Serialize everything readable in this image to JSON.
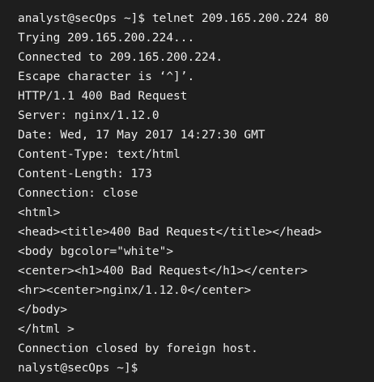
{
  "terminal": {
    "lines": [
      "analyst@secOps ~]$ telnet 209.165.200.224 80",
      "Trying 209.165.200.224...",
      "Connected to 209.165.200.224.",
      "Escape character is ‘^]’.",
      "HTTP/1.1 400 Bad Request",
      "Server: nginx/1.12.0",
      "Date: Wed, 17 May 2017 14:27:30 GMT",
      "Content-Type: text/html",
      "Content-Length: 173",
      "Connection: close",
      "<html>",
      "<head><title>400 Bad Request</title></head>",
      "<body bgcolor=\"white\">",
      "<center><h1>400 Bad Request</h1></center>",
      "<hr><center>nginx/1.12.0</center>",
      "</body>",
      "</html >",
      "Connection closed by foreign host.",
      "nalyst@secOps ~]$"
    ]
  },
  "colors": {
    "background": "#1e1e1e",
    "text": "#ececec"
  }
}
